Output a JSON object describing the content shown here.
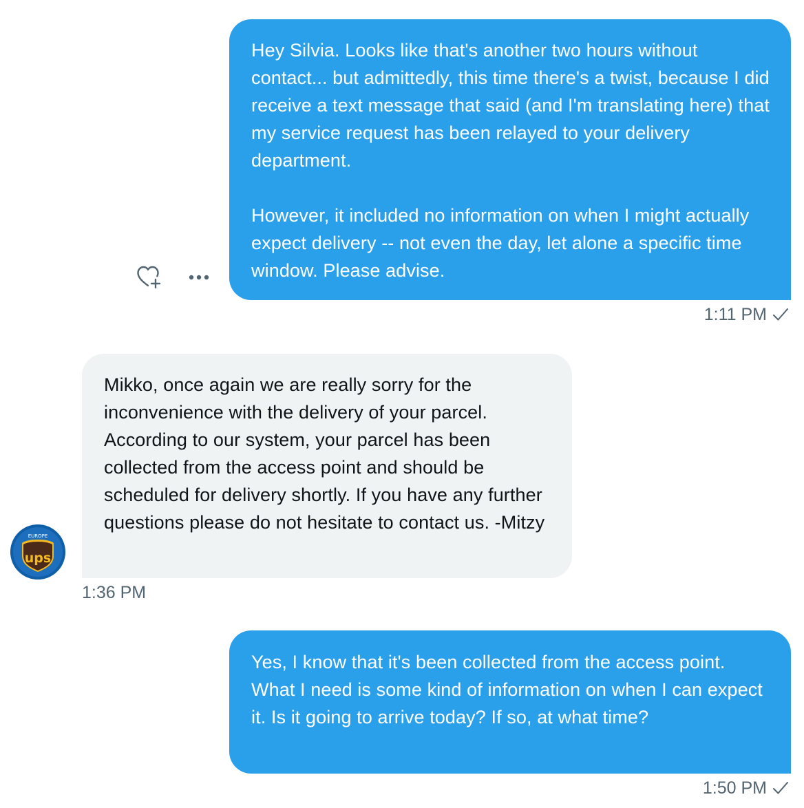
{
  "conversation": {
    "messages": [
      {
        "direction": "outgoing",
        "text": "Hey Silvia. Looks like that's another two hours without contact... but admittedly, this time there's a twist, because I did receive a text message that said (and I'm translating here) that my service request has been relayed to your delivery department.\n\nHowever, it included no information on when I might actually expect delivery -- not even the day, let alone a specific time window. Please advise.",
        "time": "1:11 PM",
        "status_icon": "check-icon"
      },
      {
        "direction": "incoming",
        "text": "Mikko, once again we are really sorry for the inconvenience with the delivery of your parcel. According to our system, your parcel has been collected from the access point and should be scheduled for delivery shortly. If you have any further questions please do not hesitate to contact us. -Mitzy",
        "time": "1:36 PM"
      },
      {
        "direction": "outgoing",
        "text": "Yes, I know that it's been collected from the access point. What I need is some kind of information on when I can expect it. Is it going to arrive today? If so, at what time?",
        "time": "1:50 PM",
        "status_icon": "check-icon"
      }
    ],
    "message_actions": {
      "react_icon": "heart-plus-icon",
      "more_icon": "more-dots-icon"
    },
    "sender_avatar": {
      "logo_text": "ups",
      "region_text": "EUROPE"
    }
  },
  "colors": {
    "outgoing_bubble": "#2aa0ea",
    "incoming_bubble": "#eff3f4",
    "timestamp": "#536471",
    "ups_brown": "#4b2a1a",
    "ups_gold": "#f5b920"
  }
}
